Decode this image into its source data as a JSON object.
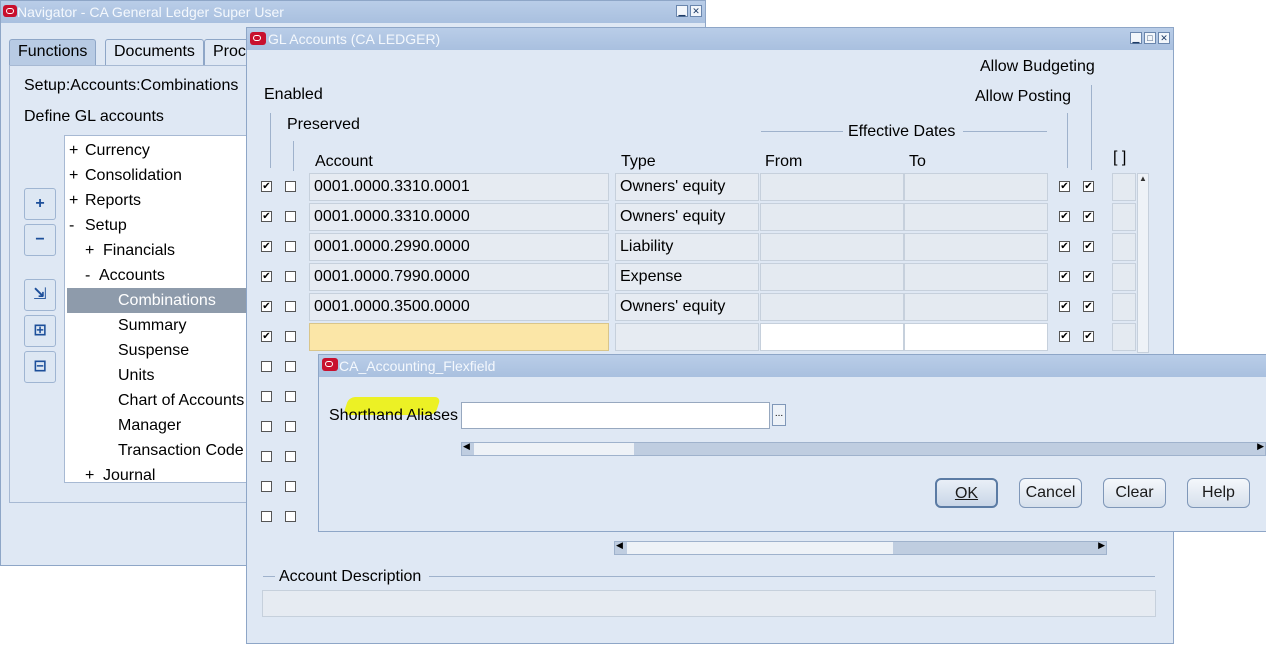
{
  "navigator": {
    "title": "Navigator - CA General Ledger Super User",
    "tabs": [
      "Functions",
      "Documents",
      "Proc"
    ],
    "path": "Setup:Accounts:Combinations",
    "description": "Define GL accounts",
    "tree": [
      {
        "prefix": "+",
        "label": "Currency"
      },
      {
        "prefix": "+",
        "label": "Consolidation"
      },
      {
        "prefix": "+",
        "label": "Reports"
      },
      {
        "prefix": "-",
        "label": "Setup"
      },
      {
        "prefix": "+",
        "label": "Financials"
      },
      {
        "prefix": "-",
        "label": "Accounts"
      },
      {
        "prefix": "",
        "label": "Combinations"
      },
      {
        "prefix": "",
        "label": "Summary"
      },
      {
        "prefix": "",
        "label": "Suspense"
      },
      {
        "prefix": "",
        "label": "Units"
      },
      {
        "prefix": "",
        "label": "Chart of Accounts"
      },
      {
        "prefix": "",
        "label": "Manager"
      },
      {
        "prefix": "",
        "label": "Transaction Code"
      },
      {
        "prefix": "+",
        "label": "Journal"
      }
    ],
    "buttons": [
      "+",
      "−",
      "⇲",
      "⊞",
      "⊟"
    ]
  },
  "gl": {
    "title": "GL Accounts (CA LEDGER)",
    "headers": {
      "enabled": "Enabled",
      "preserved": "Preserved",
      "account": "Account",
      "type": "Type",
      "effective_dates": "Effective Dates",
      "from": "From",
      "to": "To",
      "allow_budgeting": "Allow Budgeting",
      "allow_posting": "Allow Posting",
      "bracket": "[ ]"
    },
    "rows": [
      {
        "enabled": true,
        "preserved": false,
        "account": "0001.0000.3310.0001",
        "type": "Owners' equity",
        "posting": true,
        "budgeting": true
      },
      {
        "enabled": true,
        "preserved": false,
        "account": "0001.0000.3310.0000",
        "type": "Owners' equity",
        "posting": true,
        "budgeting": true
      },
      {
        "enabled": true,
        "preserved": false,
        "account": "0001.0000.2990.0000",
        "type": "Liability",
        "posting": true,
        "budgeting": true
      },
      {
        "enabled": true,
        "preserved": false,
        "account": "0001.0000.7990.0000",
        "type": "Expense",
        "posting": true,
        "budgeting": true
      },
      {
        "enabled": true,
        "preserved": false,
        "account": "0001.0000.3500.0000",
        "type": "Owners' equity",
        "posting": true,
        "budgeting": true
      },
      {
        "enabled": true,
        "preserved": false,
        "account": "",
        "type": "",
        "posting": true,
        "budgeting": true
      },
      {
        "enabled": false,
        "preserved": false,
        "account": "",
        "type": "",
        "posting": false,
        "budgeting": false
      },
      {
        "enabled": false,
        "preserved": false,
        "account": "",
        "type": "",
        "posting": false,
        "budgeting": false
      },
      {
        "enabled": false,
        "preserved": false,
        "account": "",
        "type": "",
        "posting": false,
        "budgeting": false
      },
      {
        "enabled": false,
        "preserved": false,
        "account": "",
        "type": "",
        "posting": false,
        "budgeting": false
      },
      {
        "enabled": false,
        "preserved": false,
        "account": "",
        "type": "",
        "posting": false,
        "budgeting": false
      },
      {
        "enabled": false,
        "preserved": false,
        "account": "",
        "type": "",
        "posting": false,
        "budgeting": false
      }
    ],
    "account_description_label": "Account Description",
    "account_description_value": ""
  },
  "flex": {
    "title": "CA_Accounting_Flexfield",
    "shorthand_label": "Shorthand Aliases",
    "shorthand_value": "",
    "lov_label": "...",
    "buttons": {
      "ok": "OK",
      "cancel": "Cancel",
      "clear": "Clear",
      "help": "Help"
    }
  },
  "colors": {
    "highlight": "#f0f000",
    "selection": "#8e9bab",
    "yellow_field": "#fbe6a7"
  }
}
